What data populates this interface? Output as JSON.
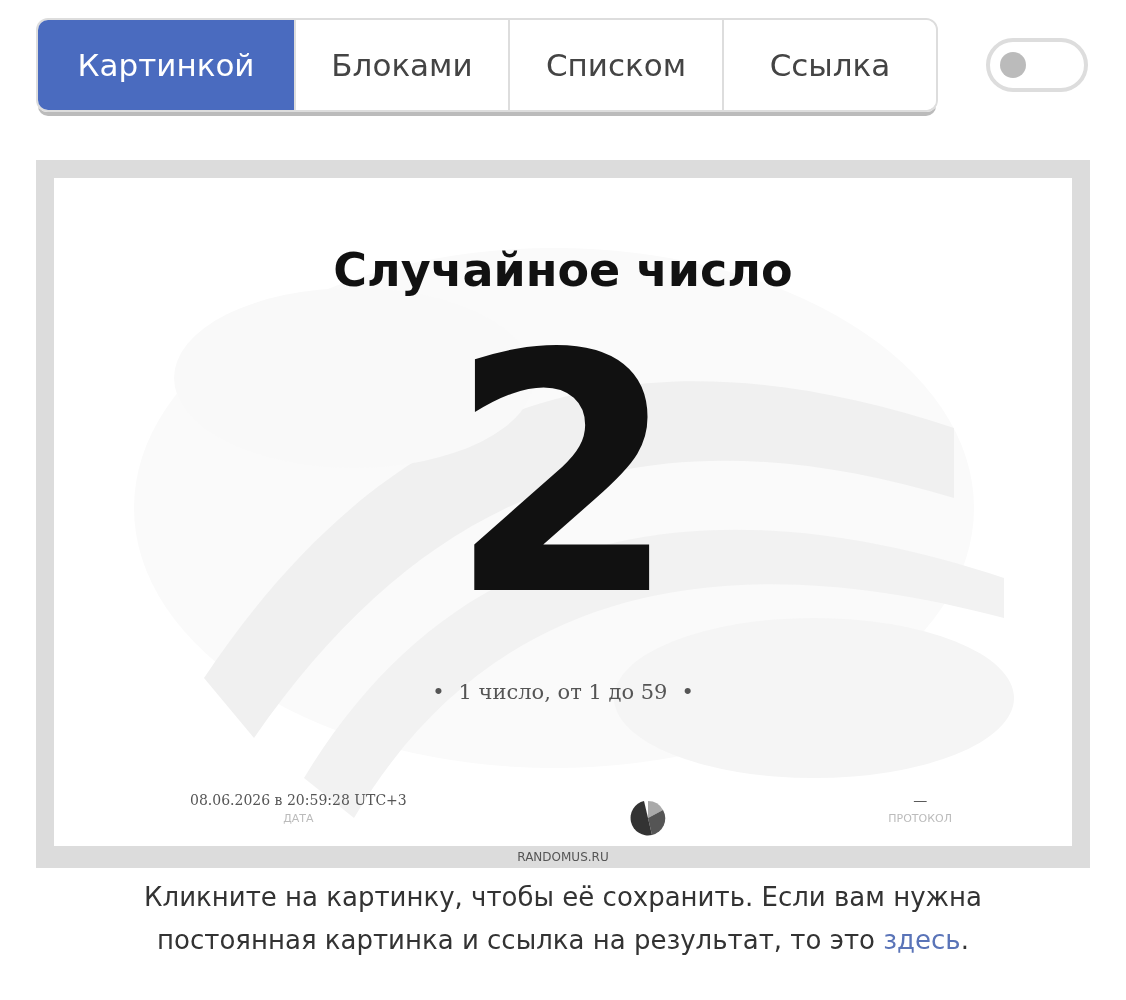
{
  "tabs": [
    {
      "label": "Картинкой",
      "selected": true
    },
    {
      "label": "Блоками",
      "selected": false
    },
    {
      "label": "Списком",
      "selected": false
    },
    {
      "label": "Ссылка",
      "selected": false
    }
  ],
  "toggle": {
    "on": false
  },
  "result_image": {
    "title": "Случайное число",
    "number": "2",
    "bullet_left": "•",
    "subtitle": "1 число, от 1 до 59",
    "bullet_right": "•",
    "date": "08.06.2026 в 20:59:28 UTC+3",
    "date_label": "ДАТА",
    "protocol": "—",
    "protocol_label": "ПРОТОКОЛ",
    "site": "RANDOMUS.RU"
  },
  "caption": {
    "text": "Кликните на картинку, чтобы её сохранить. Если вам нужна постоянная картинка и ссылка на результат, то это ",
    "link": "здесь",
    "after": "."
  }
}
